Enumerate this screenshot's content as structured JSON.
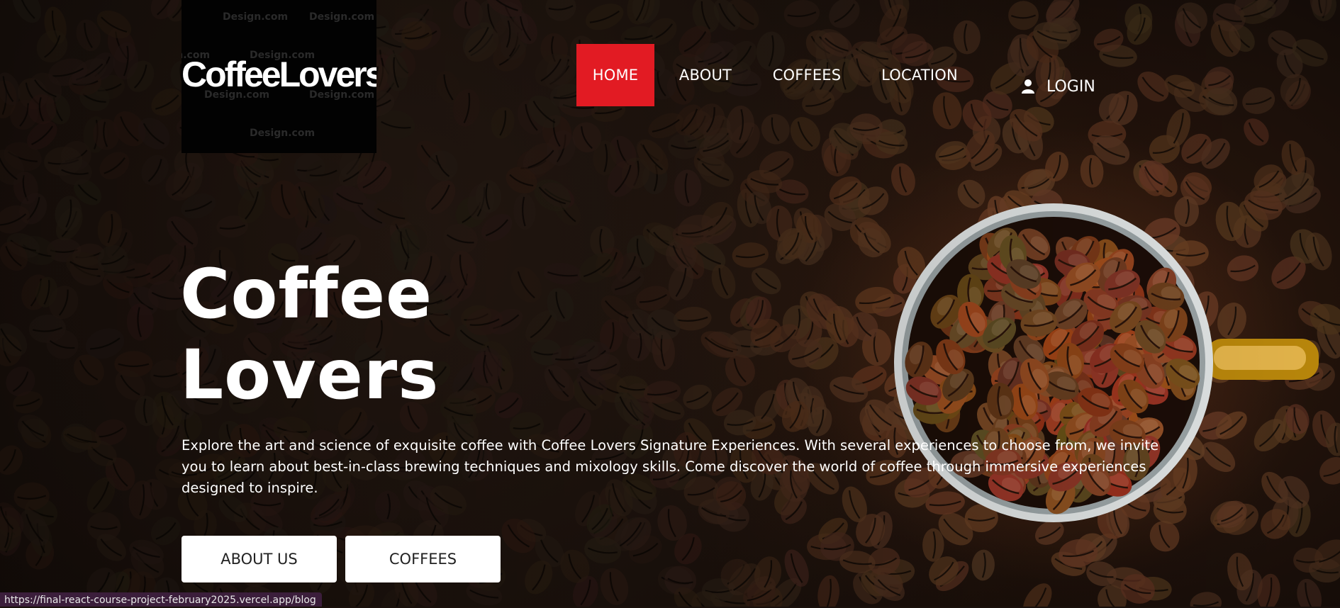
{
  "logo": {
    "text": "CoffeeLovers",
    "watermarks": [
      "Design.com",
      "Design.com",
      "Design.com",
      "Design.com",
      "Design.com",
      "Design.com",
      "Design.com"
    ]
  },
  "nav": {
    "items": [
      {
        "label": "HOME",
        "active": true
      },
      {
        "label": "ABOUT",
        "active": false
      },
      {
        "label": "COFFEES",
        "active": false
      },
      {
        "label": "LOCATION",
        "active": false
      }
    ],
    "login_label": "LOGIN",
    "active_color": "#e21b23"
  },
  "hero": {
    "title_line1": "Coffee",
    "title_line2": "Lovers",
    "description": "Explore the art and science of exquisite coffee with Coffee Lovers Signature Experiences. With several experiences to choose from, we invite you to learn about best-in-class brewing techniques and mixology skills. Come discover the world of coffee through immersive experiences designed to inspire.",
    "buttons": {
      "about_us": "ABOUT US",
      "coffees": "COFFEES"
    }
  },
  "status_bar": {
    "url": "https://final-react-course-project-february2025.vercel.app/blog"
  },
  "icons": {
    "login": "user-icon"
  }
}
